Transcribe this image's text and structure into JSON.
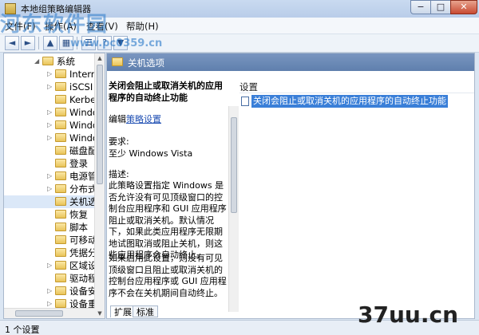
{
  "window": {
    "title": "本地组策略编辑器",
    "min": "−",
    "max": "□",
    "close": "✕"
  },
  "menu": [
    {
      "label": "文件(F)"
    },
    {
      "label": "操作(A)"
    },
    {
      "label": "查看(V)"
    },
    {
      "label": "帮助(H)"
    }
  ],
  "toolbar": {
    "back": "◄",
    "forward": "►",
    "up": "▲",
    "show": "▦",
    "help": "?",
    "props": "☰",
    "filter": "▼"
  },
  "tree": {
    "items": [
      {
        "label": "系统",
        "arrow": "◢"
      },
      {
        "label": "Interne",
        "arrow": "▷"
      },
      {
        "label": "iSCSI",
        "arrow": "▷"
      },
      {
        "label": "Kerbe",
        "arrow": ""
      },
      {
        "label": "Windo",
        "arrow": "▷"
      },
      {
        "label": "Windo",
        "arrow": "▷"
      },
      {
        "label": "Windo",
        "arrow": "▷"
      },
      {
        "label": "磁盘配",
        "arrow": ""
      },
      {
        "label": "登录",
        "arrow": ""
      },
      {
        "label": "电源管",
        "arrow": "▷"
      },
      {
        "label": "分布式",
        "arrow": "▷"
      },
      {
        "label": "关机选",
        "arrow": ""
      },
      {
        "label": "恢复",
        "arrow": ""
      },
      {
        "label": "脚本",
        "arrow": ""
      },
      {
        "label": "可移动",
        "arrow": ""
      },
      {
        "label": "凭据分",
        "arrow": ""
      },
      {
        "label": "区域设",
        "arrow": "▷"
      },
      {
        "label": "驱动程",
        "arrow": ""
      },
      {
        "label": "设备安",
        "arrow": "▷"
      },
      {
        "label": "设备重",
        "arrow": "▷"
      }
    ],
    "selected_index": 11
  },
  "right": {
    "header": "关机选项",
    "description": {
      "title": "关闭会阻止或取消关机的应用程序的自动终止功能",
      "edit_prefix": "编辑",
      "edit_link": "策略设置",
      "req_label": "要求:",
      "req_value": "至少 Windows Vista",
      "desc_label": "描述:",
      "body1": "此策略设置指定 Windows 是否允许没有可见顶级窗口的控制台应用程序和 GUI 应用程序阻止或取消关机。默认情况下，如果此类应用程序无限期地试图取消或阻止关机，则这些应用程序会自动终止。",
      "body2": "如果启用此设置，则没有可见顶级窗口且阻止或取消关机的控制台应用程序或 GUI 应用程序不会在关机期间自动终止。"
    },
    "settings_header": "设置",
    "settings": [
      {
        "label": "关闭会阻止或取消关机的应用程序的自动终止功能"
      }
    ],
    "tabs": [
      {
        "label": "扩展"
      },
      {
        "label": "标准"
      }
    ]
  },
  "status": {
    "text": "1 个设置"
  },
  "watermark": {
    "top": "河东软件园",
    "url": "www.pc0359.cn",
    "bottom": "37uu.cn"
  }
}
